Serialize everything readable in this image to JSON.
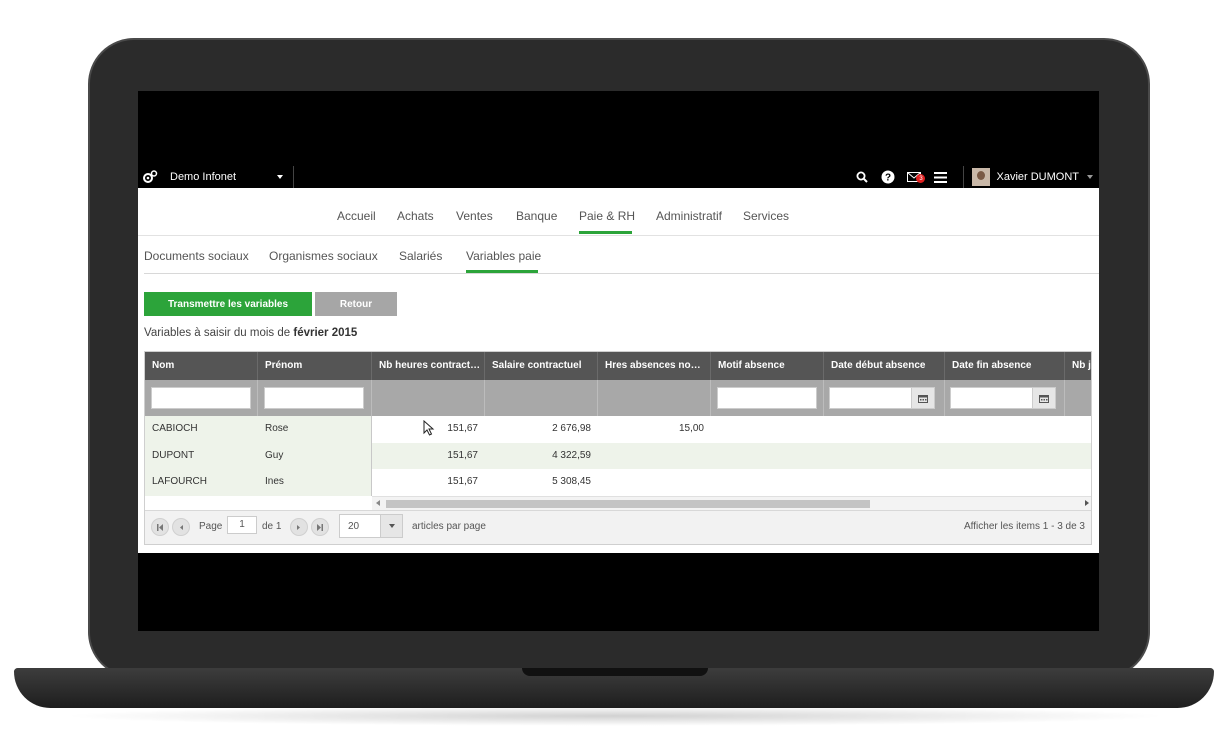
{
  "topbar": {
    "company": "Demo Infonet",
    "user_name": "Xavier DUMONT",
    "notification_count": "3"
  },
  "main_nav": [
    "Accueil",
    "Achats",
    "Ventes",
    "Banque",
    "Paie & RH",
    "Administratif",
    "Services"
  ],
  "main_nav_active": "Paie & RH",
  "sub_nav": [
    "Documents sociaux",
    "Organismes sociaux",
    "Salariés",
    "Variables paie"
  ],
  "sub_nav_active": "Variables paie",
  "actions": {
    "transmit_label": "Transmettre les variables",
    "back_label": "Retour"
  },
  "subtitle": {
    "prefix": "Variables à saisir du mois de ",
    "month": "février 2015"
  },
  "grid": {
    "columns": [
      "Nom",
      "Prénom",
      "Nb heures contract…",
      "Salaire contractuel",
      "Hres absences no…",
      "Motif absence",
      "Date début absence",
      "Date fin absence",
      "Nb j"
    ],
    "rows": [
      {
        "nom": "CABIOCH",
        "prenom": "Rose",
        "heures": "151,67",
        "salaire": "2 676,98",
        "absences": "15,00"
      },
      {
        "nom": "DUPONT",
        "prenom": "Guy",
        "heures": "151,67",
        "salaire": "4 322,59",
        "absences": ""
      },
      {
        "nom": "LAFOURCH",
        "prenom": "Ines",
        "heures": "151,67",
        "salaire": "5 308,45",
        "absences": ""
      }
    ]
  },
  "pager": {
    "page_label": "Page",
    "page_value": "1",
    "of_label": "de 1",
    "page_size": "20",
    "per_page_label": "articles par page",
    "summary": "Afficher les items 1 - 3 de 3"
  },
  "colors": {
    "accent": "#2ca43a",
    "header_bg": "#555555",
    "row_alt": "#eef3ea",
    "badge": "#e02020"
  }
}
